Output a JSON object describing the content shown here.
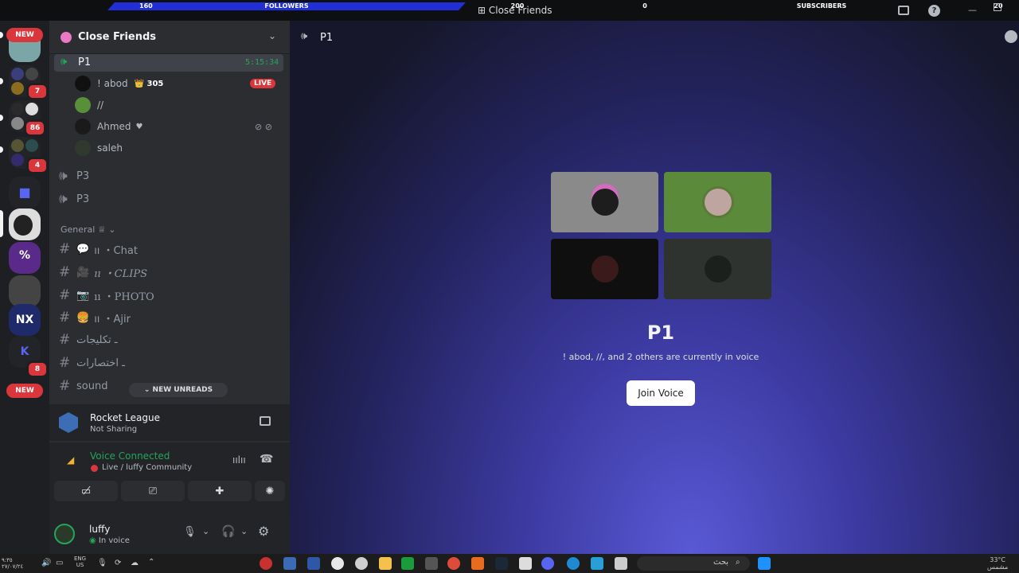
{
  "overlay": {
    "followers_left": "160",
    "followers_label": "FOLLOWERS",
    "followers_right": "200",
    "subscribers_left": "0",
    "subscribers_label": "SUBSCRIBERS",
    "subscribers_right": "20",
    "window_title": "Close Friends"
  },
  "rail": {
    "new_label": "NEW",
    "badges": [
      "7",
      "86",
      "4",
      "8"
    ],
    "new_label_bottom": "NEW"
  },
  "sidebar": {
    "server_name": "Close Friends",
    "voice_channels": [
      {
        "name": "P1",
        "timer": "5:15:34"
      },
      {
        "name": "P3"
      },
      {
        "name": "P3"
      }
    ],
    "members": [
      {
        "name": "! abod",
        "extra": "305",
        "badge": "LIVE"
      },
      {
        "name": "//"
      },
      {
        "name": "Ahmed"
      },
      {
        "name": "saleh"
      }
    ],
    "category": "General ♕",
    "text_channels": [
      {
        "name": "ıı ・Chat"
      },
      {
        "name": "ıı ・CLIPS"
      },
      {
        "name": "ıı ・PHOTO"
      },
      {
        "name": "ıı ・Ajir"
      },
      {
        "name": "ـ تكليجات"
      },
      {
        "name": "ـ اختصارات"
      },
      {
        "name": "sound"
      }
    ],
    "new_unreads": "NEW UNREADS"
  },
  "game_panel": {
    "title": "Rocket League",
    "subtitle": "Not Sharing"
  },
  "voice_panel": {
    "status": "Voice Connected",
    "channel": "Live / luffy Community"
  },
  "user_panel": {
    "username": "luffy",
    "status": "In voice"
  },
  "main": {
    "channel_title": "P1",
    "heading": "P1",
    "description": "! abod, //, and 2 others are currently in voice",
    "join_button": "Join Voice"
  },
  "taskbar": {
    "lang_top": "ENG",
    "lang_bottom": "US",
    "search_placeholder": "بحث",
    "temp": "33°C",
    "weather": "مشمس"
  },
  "colors": {
    "accent": "#5865f2",
    "green": "#23a55a",
    "red": "#da373c",
    "live": "#da373c"
  }
}
